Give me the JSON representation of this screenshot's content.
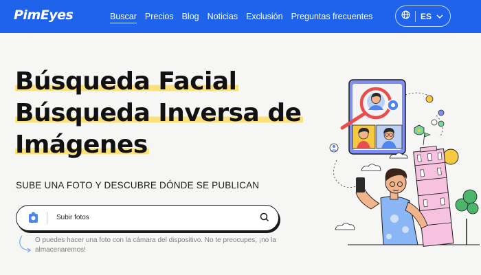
{
  "brand": {
    "name": "PimEyes"
  },
  "nav": {
    "items": [
      "Buscar",
      "Precios",
      "Blog",
      "Noticias",
      "Exclusión",
      "Preguntas frecuentes"
    ],
    "active_index": 0
  },
  "language": {
    "code": "ES",
    "icon": "globe-icon"
  },
  "hero": {
    "title_lines": [
      "Búsqueda Facial",
      "Búsqueda Inversa de",
      "Imágenes"
    ],
    "subtitle": "SUBE UNA FOTO Y DESCUBRE DÓNDE SE PUBLICAN"
  },
  "search": {
    "upload_label": "Subir fotos",
    "camera_icon": "camera-icon",
    "search_icon": "search-icon",
    "hint": "O puedes hacer una foto con la cámara del dispositivo. No te preocupes, ¡no la almacenaremos!"
  },
  "colors": {
    "nav_background": "#1f63ea",
    "highlight": "#fbe17c",
    "page_background": "#f6f6f4"
  }
}
